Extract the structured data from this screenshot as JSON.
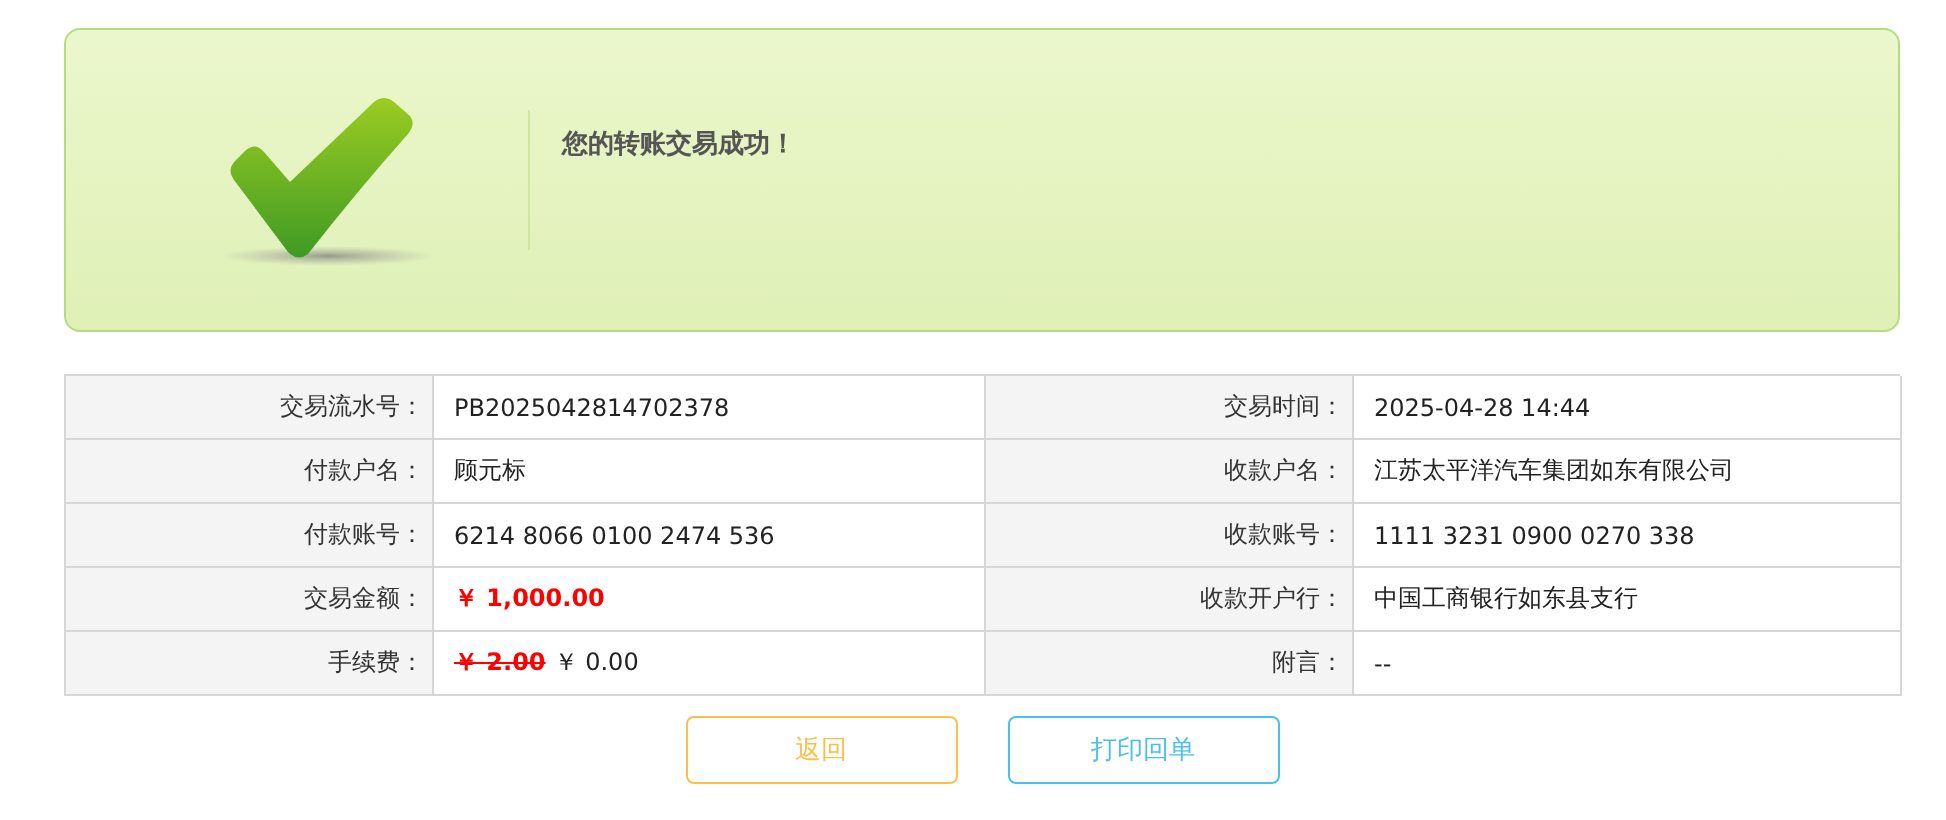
{
  "banner": {
    "message": "您的转账交易成功！"
  },
  "rows": [
    {
      "cells": [
        {
          "label": "交易流水号：",
          "value": "PB2025042814702378",
          "kind": "plain"
        },
        {
          "label": "交易时间：",
          "value": "2025-04-28 14:44",
          "kind": "plain"
        }
      ]
    },
    {
      "cells": [
        {
          "label": "付款户名：",
          "value": "顾元标",
          "kind": "plain"
        },
        {
          "label": "收款户名：",
          "value": "江苏太平洋汽车集团如东有限公司",
          "kind": "plain"
        }
      ]
    },
    {
      "cells": [
        {
          "label": "付款账号：",
          "value": "6214 8066 0100 2474 536",
          "kind": "plain"
        },
        {
          "label": "收款账号：",
          "value": "1111 3231 0900 0270 338",
          "kind": "plain"
        }
      ]
    },
    {
      "cells": [
        {
          "label": "交易金额：",
          "value": "￥ 1,000.00",
          "kind": "amount"
        },
        {
          "label": "收款开户行：",
          "value": "中国工商银行如东县支行",
          "kind": "plain"
        }
      ]
    },
    {
      "cells": [
        {
          "label": "手续费：",
          "original": "￥ 2.00",
          "value": "￥ 0.00",
          "kind": "fee"
        },
        {
          "label": "附言：",
          "value": "--",
          "kind": "plain"
        }
      ]
    }
  ],
  "buttons": [
    {
      "label": "返回",
      "color": "#f9c04c"
    },
    {
      "label": "打印回单",
      "color": "#4cc0ec"
    }
  ]
}
